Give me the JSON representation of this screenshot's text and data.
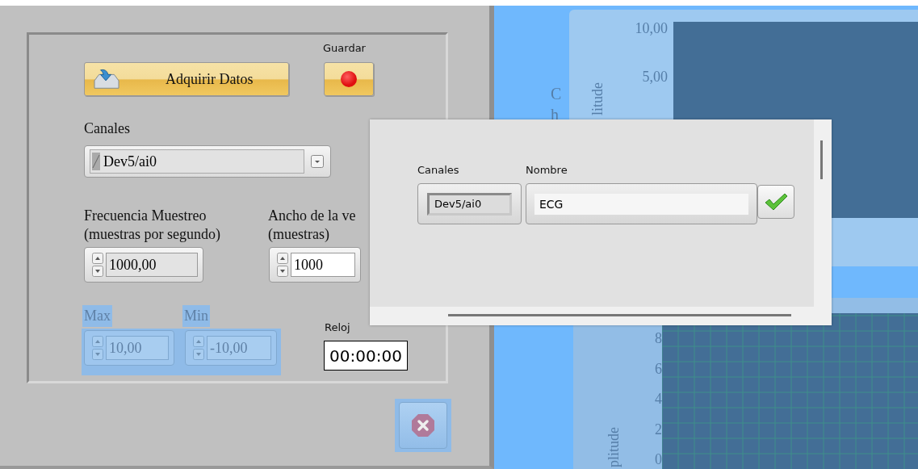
{
  "panel": {
    "acquire_button": {
      "label": "Adquirir Datos"
    },
    "save": {
      "label": "Guardar",
      "on": true
    },
    "channels": {
      "label": "Canales",
      "value": "Dev5/ai0"
    },
    "sample_rate": {
      "label": [
        "Frecuencia  Muestreo",
        "(muestras por segundo)"
      ],
      "value": "1000,00"
    },
    "window_width": {
      "label": [
        "Ancho de la ve",
        "(muestras)"
      ],
      "value": "1000"
    },
    "max": {
      "label": "Max",
      "value": "10,00",
      "selected": true
    },
    "min": {
      "label": "Min",
      "value": "-10,00",
      "selected": true
    },
    "clock": {
      "label": "Reloj",
      "value": "00:00:00"
    },
    "stop_button": {
      "selected": true
    }
  },
  "graphs": {
    "side_label": [
      "C",
      "h"
    ],
    "upper": {
      "axis_label": "litude",
      "yticks": [
        "10,00",
        "5,00"
      ]
    },
    "lower": {
      "axis_label": "plitude",
      "yticks": [
        "8",
        "6",
        "4",
        "2",
        "0"
      ]
    }
  },
  "dialog": {
    "columns": [
      "Canales",
      "Nombre"
    ],
    "channel": "Dev5/ai0",
    "name": "ECG"
  }
}
